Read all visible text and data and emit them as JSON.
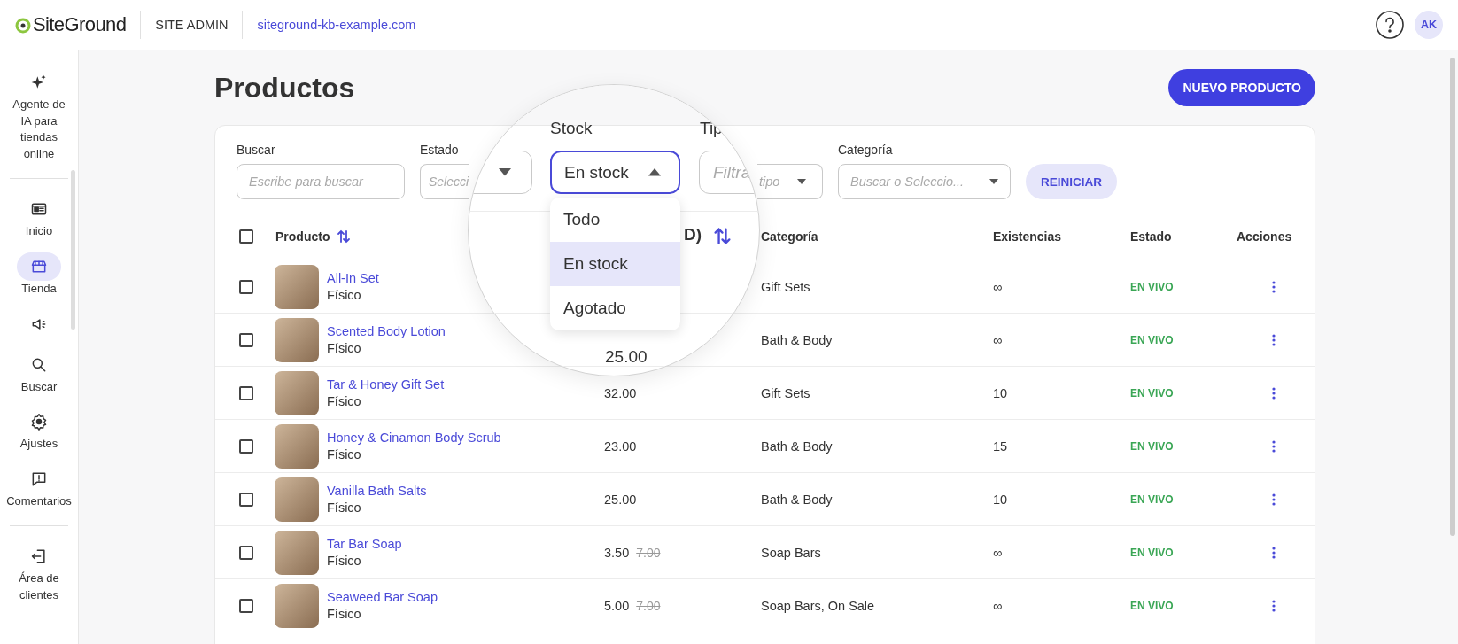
{
  "header": {
    "logo": "SiteGround",
    "section": "SITE ADMIN",
    "domain": "siteground-kb-example.com",
    "avatar": "AK"
  },
  "sidebar": {
    "sections": [
      {
        "items": [
          {
            "label": "Agente de IA para tiendas online",
            "selected": false
          }
        ]
      },
      {
        "items": [
          {
            "label": "Inicio",
            "selected": false
          },
          {
            "label": "Tienda",
            "selected": true
          },
          {
            "selected": false
          },
          {
            "label": "Buscar",
            "selected": false
          },
          {
            "label": "Ajustes",
            "selected": false
          },
          {
            "label": "Comentarios",
            "selected": false
          }
        ]
      },
      {
        "items": [
          {
            "label": "Área de clientes",
            "selected": false
          }
        ]
      }
    ]
  },
  "page": {
    "title": "Productos",
    "new_button": "NUEVO PRODUCTO"
  },
  "filters": {
    "fields": [
      {
        "kind": "text",
        "label": "Buscar",
        "placeholder": "Escribe para buscar"
      },
      {
        "kind": "leftpart",
        "label": "Estado",
        "placeholder": "Selecci"
      },
      {
        "kind": "gap"
      },
      {
        "kind": "rightpart",
        "placeholder": "tipo"
      },
      {
        "kind": "select",
        "label": "Categoría",
        "placeholder": "Buscar o Seleccio..."
      }
    ],
    "reset_button": "REINICIAR"
  },
  "magnifier": {
    "stock_label": "Stock",
    "stock_value": "En stock",
    "expanded": true,
    "options": [
      {
        "label": "Todo",
        "selected": false
      },
      {
        "label": "En stock",
        "selected": true
      },
      {
        "label": "Agotado",
        "selected": false
      }
    ],
    "tipo_label": "Tip",
    "tipo_placeholder": "Filtra",
    "column_fragment": "D)",
    "price_fragment": "25.00"
  },
  "table": {
    "all_checked": false,
    "columns": [
      {
        "label": "Producto",
        "sortable": true
      },
      {
        "label": "Categoría",
        "sortable": false
      },
      {
        "label": "Existencias",
        "sortable": false
      },
      {
        "label": "Estado",
        "sortable": false
      },
      {
        "label": "Acciones",
        "sortable": false
      }
    ],
    "rows": [
      {
        "checked": false,
        "name": "All-In Set",
        "type": "Físico",
        "category": "Gift Sets",
        "stock": "∞",
        "status": "EN VIVO"
      },
      {
        "checked": false,
        "name": "Scented Body Lotion",
        "type": "Físico",
        "category": "Bath & Body",
        "stock": "∞",
        "status": "EN VIVO"
      },
      {
        "checked": false,
        "name": "Tar & Honey Gift Set",
        "type": "Físico",
        "price": "32.00",
        "category": "Gift Sets",
        "stock": "10",
        "status": "EN VIVO"
      },
      {
        "checked": false,
        "name": "Honey & Cinamon Body Scrub",
        "type": "Físico",
        "price": "23.00",
        "category": "Bath & Body",
        "stock": "15",
        "status": "EN VIVO"
      },
      {
        "checked": false,
        "name": "Vanilla Bath Salts",
        "type": "Físico",
        "price": "25.00",
        "category": "Bath & Body",
        "stock": "10",
        "status": "EN VIVO"
      },
      {
        "checked": false,
        "name": "Tar Bar Soap",
        "type": "Físico",
        "price": "3.50",
        "old_price": "7.00",
        "category": "Soap Bars",
        "stock": "∞",
        "status": "EN VIVO"
      },
      {
        "checked": false,
        "name": "Seaweed Bar Soap",
        "type": "Físico",
        "price": "5.00",
        "old_price": "7.00",
        "category": "Soap Bars, On Sale",
        "stock": "∞",
        "status": "EN VIVO"
      }
    ]
  }
}
